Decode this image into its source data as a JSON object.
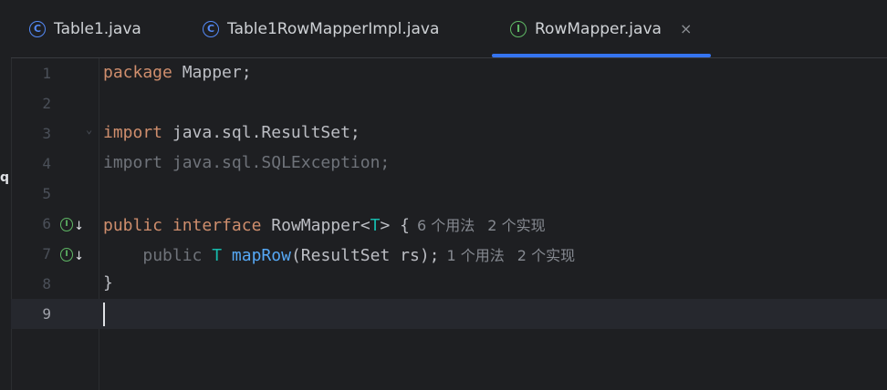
{
  "tabs": [
    {
      "label": "Table1.java",
      "icon": "class-icon",
      "icon_glyph": "C",
      "active": false
    },
    {
      "label": "Table1RowMapperImpl.java",
      "icon": "class-icon",
      "icon_glyph": "C",
      "active": false
    },
    {
      "label": "RowMapper.java",
      "icon": "interface-icon",
      "icon_glyph": "I",
      "active": true,
      "close": "×"
    }
  ],
  "left_strip_char": "q",
  "gutter": {
    "implemented_glyph": "I",
    "arrow_glyph": "↓"
  },
  "lines": {
    "l1": {
      "num": "1",
      "kw": "package",
      "rest": " Mapper;"
    },
    "l2": {
      "num": "2"
    },
    "l3": {
      "num": "3",
      "kw": "import",
      "rest": " java.sql.ResultSet;"
    },
    "l4": {
      "num": "4",
      "text": "import java.sql.SQLException;"
    },
    "l5": {
      "num": "5"
    },
    "l6": {
      "num": "6",
      "kw1": "public",
      "kw2": "interface",
      "name": "RowMapper",
      "lt": "<",
      "tparam": "T",
      "gt": "> {",
      "hint1": "6 个用法",
      "hint2": "2 个实现"
    },
    "l7": {
      "num": "7",
      "kw": "public",
      "type": "T",
      "method": "mapRow",
      "args": "(ResultSet rs);",
      "hint1": "1 个用法",
      "hint2": "2 个实现"
    },
    "l8": {
      "num": "8",
      "text": "}"
    },
    "l9": {
      "num": "9"
    }
  },
  "colors": {
    "accent": "#3574f0",
    "keyword": "#cf8e6d",
    "type_param": "#16baac",
    "method": "#56a8f5",
    "text": "#bcbec4",
    "background": "#1e1f22"
  }
}
